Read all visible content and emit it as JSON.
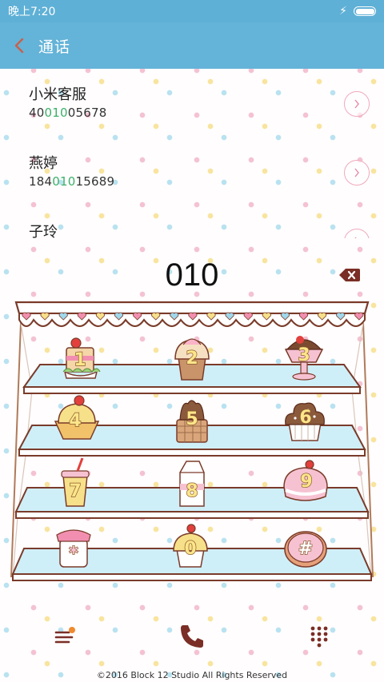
{
  "status_bar": {
    "time": "晚上7:20",
    "charging_icon": "bolt-icon",
    "battery_icon": "battery-icon"
  },
  "header": {
    "title": "通话",
    "back_icon": "chevron-left-icon"
  },
  "contacts": [
    {
      "name": "小米客服",
      "number_pre": "40",
      "number_match": "010",
      "number_post": "05678"
    },
    {
      "name": "燕婷",
      "number_pre": "184",
      "number_match": "010",
      "number_post": "15689"
    },
    {
      "name": "子玲",
      "number_pre": "",
      "number_match": "",
      "number_post": ""
    }
  ],
  "dialer": {
    "digits": "010",
    "backspace_icon": "backspace-icon"
  },
  "keypad": {
    "keys": [
      "1",
      "2",
      "3",
      "4",
      "5",
      "6",
      "7",
      "8",
      "9",
      "*",
      "0",
      "#"
    ]
  },
  "bottom_bar": {
    "menu_icon": "menu-icon",
    "call_icon": "phone-icon",
    "dialpad_icon": "dialpad-icon"
  },
  "footer": {
    "copyright": "©2016 Block 12 Studio All Rights Reserved"
  },
  "colors": {
    "header": "#64b3d8",
    "status_bar": "#5fb0d6",
    "match_highlight": "#3bb06b",
    "accent_brown": "#8a3a2a",
    "shelf_blue": "#cfeff8"
  }
}
